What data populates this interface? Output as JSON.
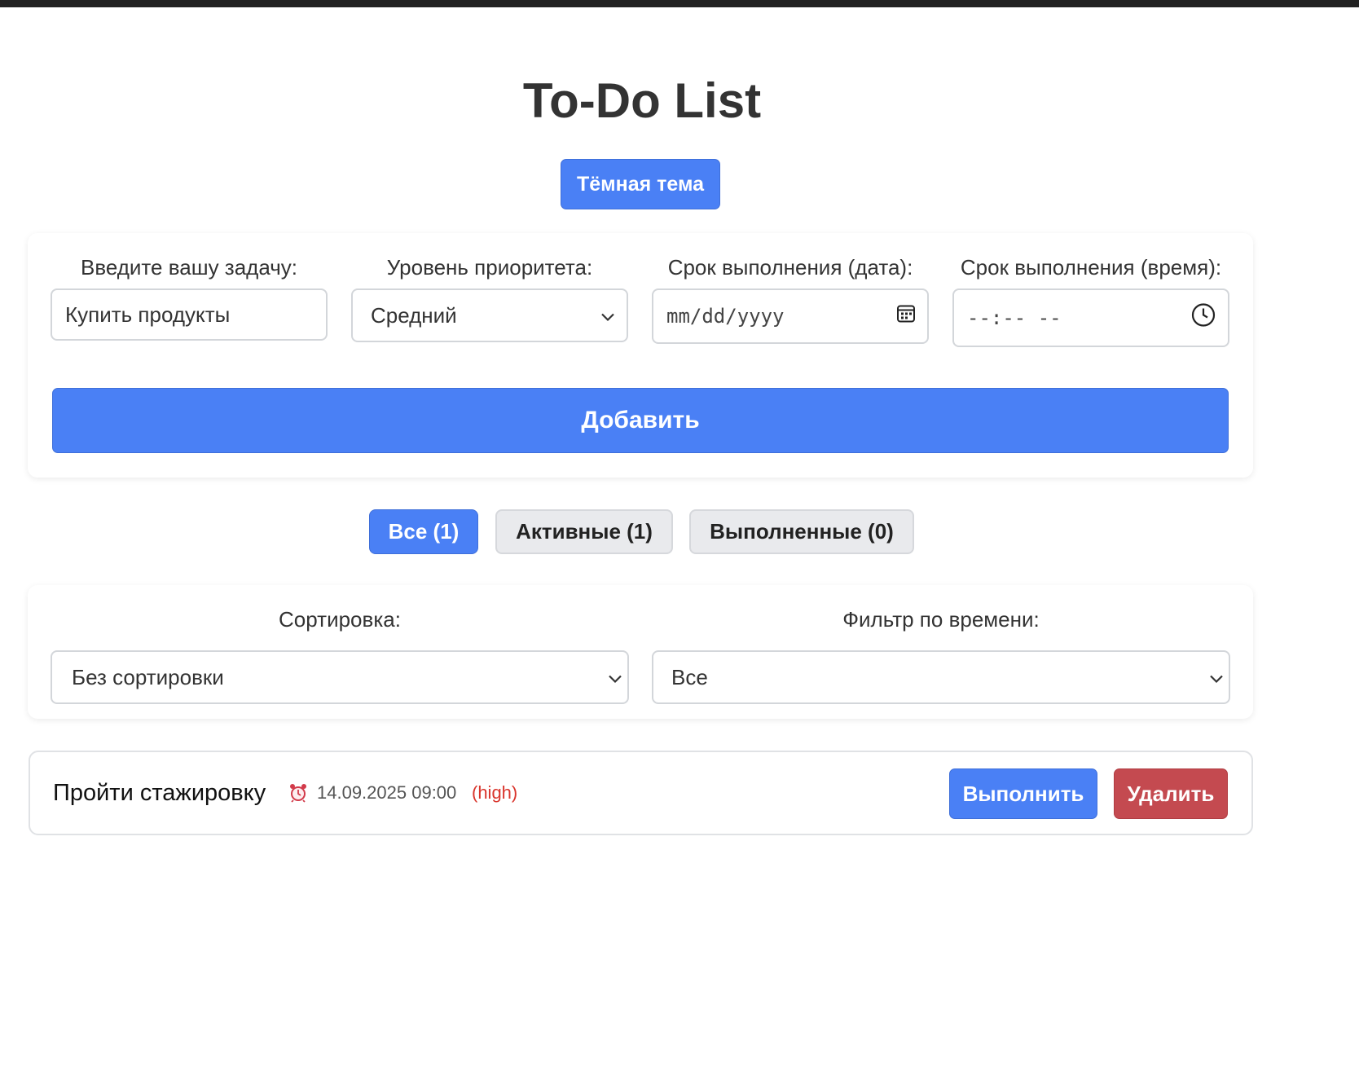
{
  "header": {
    "title": "To-Do List",
    "theme_button": "Тёмная тема"
  },
  "form": {
    "task_label": "Введите вашу задачу:",
    "task_value": "Купить продукты",
    "priority_label": "Уровень приоритета:",
    "priority_value": "Средний",
    "date_label": "Срок выполнения (дата):",
    "date_placeholder": "mm/dd/yyyy",
    "time_label": "Срок выполнения (время):",
    "time_placeholder": "--:-- --",
    "add_button": "Добавить"
  },
  "tabs": [
    {
      "label": "Все (1)",
      "active": true
    },
    {
      "label": "Активные (1)",
      "active": false
    },
    {
      "label": "Выполненные (0)",
      "active": false
    }
  ],
  "controls": {
    "sort_label": "Сортировка:",
    "sort_value": "Без сортировки",
    "time_filter_label": "Фильтр по времени:",
    "time_filter_value": "Все"
  },
  "tasks": [
    {
      "title": "Пройти стажировку",
      "icon": "alarm-clock-icon",
      "due": "14.09.2025 09:00",
      "priority": "(high)",
      "complete_button": "Выполнить",
      "delete_button": "Удалить"
    }
  ],
  "colors": {
    "accent": "#4a80f5",
    "danger": "#c44a50",
    "priority_high": "#d9342b"
  }
}
